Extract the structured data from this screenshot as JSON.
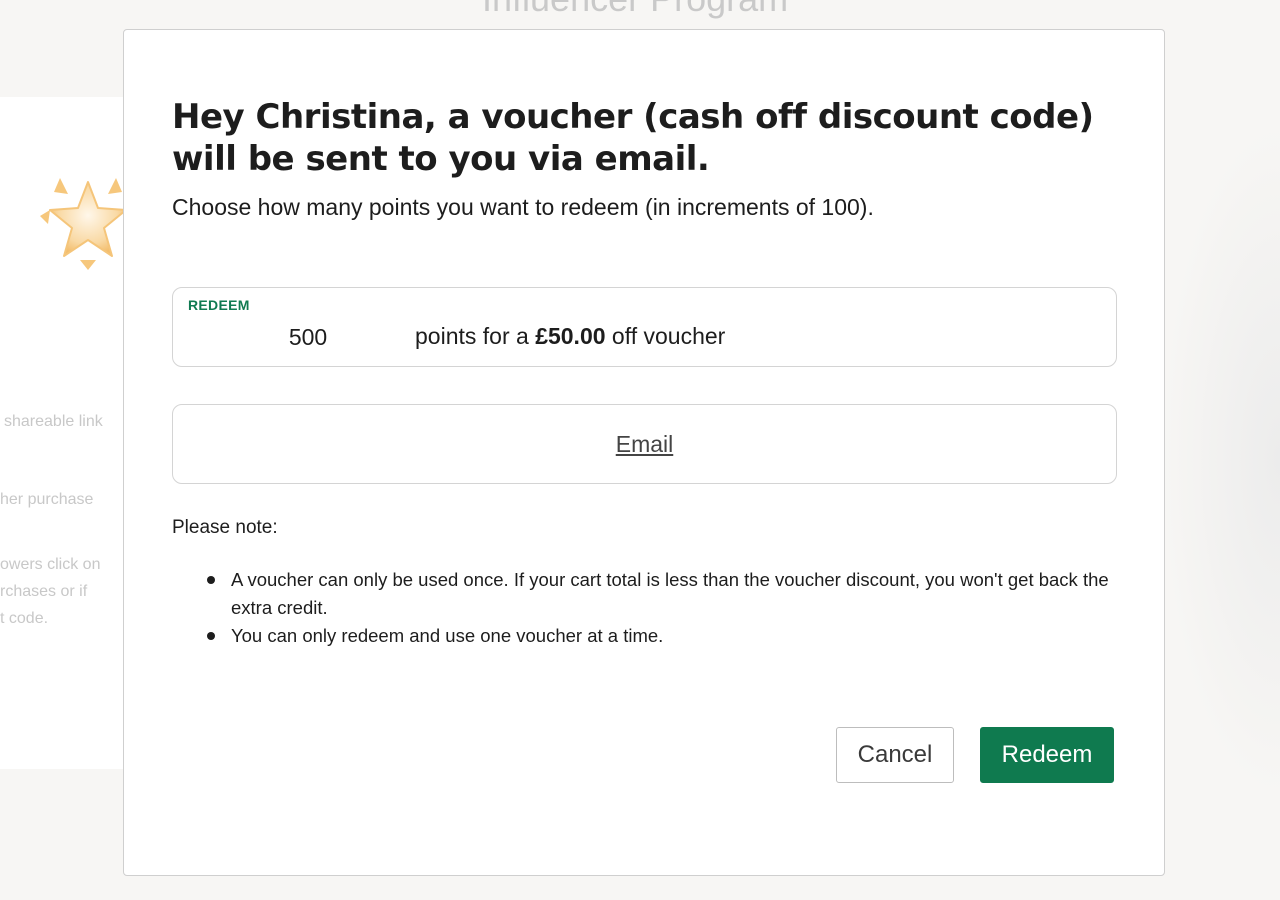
{
  "background": {
    "title": "Influencer Program",
    "snippets": {
      "line1": "shareable link",
      "line2": "her purchase",
      "line3a": "owers click on",
      "line3b": "rchases or if",
      "line3c": "t code."
    },
    "icon": "star-icon"
  },
  "modal": {
    "heading": "Hey Christina, a voucher (cash off discount code) will be sent to you via email.",
    "subheading": "Choose how many points you want to redeem (in increments of 100).",
    "redeem_field": {
      "label": "REDEEM",
      "value": "500",
      "text_before": "points for a ",
      "amount": "£50.00",
      "text_after": " off voucher"
    },
    "delivery_method": "Email",
    "note_title": "Please note:",
    "notes": [
      "A voucher can only be used once. If your cart total is less than the voucher discount, you won't get back the extra credit.",
      "You can only redeem and use one voucher at a time."
    ],
    "buttons": {
      "cancel": "Cancel",
      "redeem": "Redeem"
    }
  },
  "colors": {
    "accent": "#0f7a4f",
    "label_green": "#107a51",
    "star": "#f6c77c"
  }
}
